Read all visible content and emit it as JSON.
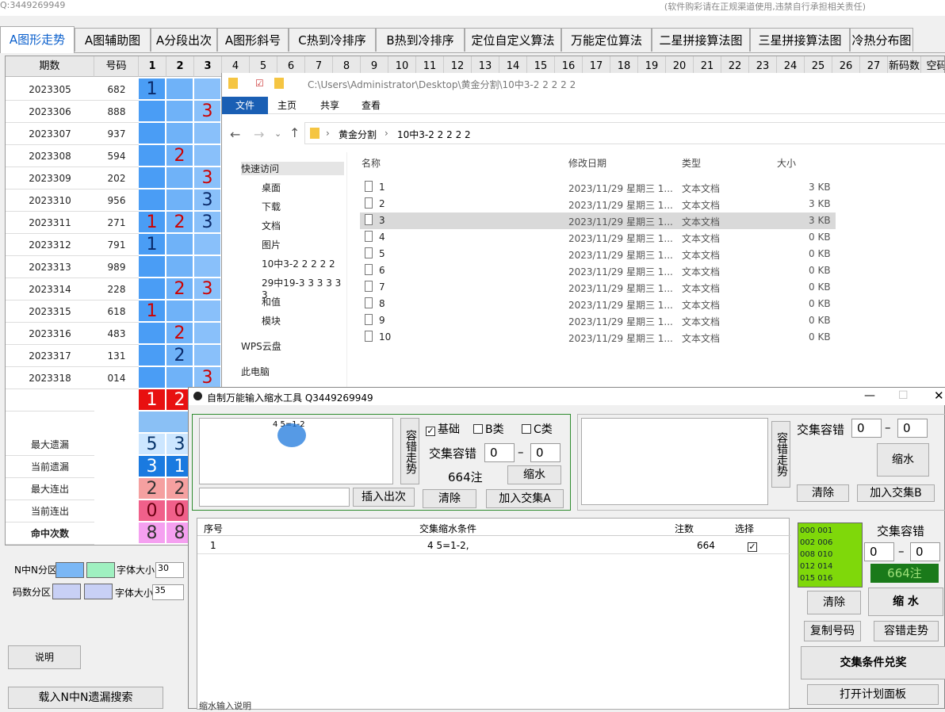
{
  "topbar": {
    "left": "Q:3449269949",
    "right": "(软件购彩请在正规渠道使用,违禁自行承担相关责任)"
  },
  "tabs": [
    "A图形走势",
    "A图辅助图",
    "A分段出次",
    "A图形斜号",
    "C热到冷排序",
    "B热到冷排序",
    "定位自定义算法",
    "万能定位算法",
    "二星拼接算法图",
    "三星拼接算法图",
    "冷热分布图"
  ],
  "grid": {
    "headers": {
      "period": "期数",
      "code": "号码",
      "nums": [
        "1",
        "2",
        "3",
        "4",
        "5",
        "6",
        "7",
        "8",
        "9",
        "10",
        "11",
        "12",
        "13",
        "14",
        "15",
        "16",
        "17",
        "18",
        "19",
        "20",
        "21",
        "22",
        "23",
        "24",
        "25",
        "26",
        "27"
      ],
      "newcode": "新码数",
      "empty": "空码"
    },
    "rows": [
      {
        "p": "2023305",
        "c": "682",
        "d": [
          "1",
          "",
          ""
        ]
      },
      {
        "p": "2023306",
        "c": "888",
        "d": [
          "",
          "",
          "3"
        ]
      },
      {
        "p": "2023307",
        "c": "937",
        "d": [
          "",
          "",
          ""
        ]
      },
      {
        "p": "2023308",
        "c": "594",
        "d": [
          "",
          "2",
          ""
        ]
      },
      {
        "p": "2023309",
        "c": "202",
        "d": [
          "",
          "",
          "3"
        ]
      },
      {
        "p": "2023310",
        "c": "956",
        "d": [
          "",
          "",
          "3"
        ]
      },
      {
        "p": "2023311",
        "c": "271",
        "d": [
          "1",
          "2",
          "3"
        ]
      },
      {
        "p": "2023312",
        "c": "791",
        "d": [
          "1",
          "",
          ""
        ]
      },
      {
        "p": "2023313",
        "c": "989",
        "d": [
          "",
          "",
          ""
        ]
      },
      {
        "p": "2023314",
        "c": "228",
        "d": [
          "",
          "2",
          "3"
        ]
      },
      {
        "p": "2023315",
        "c": "618",
        "d": [
          "1",
          "",
          ""
        ]
      },
      {
        "p": "2023316",
        "c": "483",
        "d": [
          "",
          "2",
          ""
        ]
      },
      {
        "p": "2023317",
        "c": "131",
        "d": [
          "",
          "2",
          ""
        ]
      },
      {
        "p": "2023318",
        "c": "014",
        "d": [
          "",
          "",
          "3"
        ]
      }
    ],
    "predict": [
      "1",
      "2"
    ],
    "stats": [
      {
        "label": "最大遗漏",
        "v": [
          "5",
          "3"
        ]
      },
      {
        "label": "当前遗漏",
        "v": [
          "3",
          "1"
        ]
      },
      {
        "label": "最大连出",
        "v": [
          "2",
          "2"
        ]
      },
      {
        "label": "当前连出",
        "v": [
          "0",
          "0"
        ]
      },
      {
        "label": "命中次数",
        "v": [
          "8",
          "8"
        ]
      }
    ]
  },
  "left_panel": {
    "nzone": "N中N分区",
    "fsize": "字体大小",
    "fsize1": "30",
    "codezone": "码数分区",
    "fsize2": "35",
    "explain": "说明",
    "load": "载入N中N遗漏搜索"
  },
  "explorer": {
    "path": "C:\\Users\\Administrator\\Desktop\\黄金分割\\10中3-2 2 2 2 2",
    "ribbon": [
      "文件",
      "主页",
      "共享",
      "查看"
    ],
    "crumbs": [
      "黄金分割",
      "10中3-2 2 2 2 2"
    ],
    "cols": [
      "名称",
      "修改日期",
      "类型",
      "大小"
    ],
    "nav": [
      "快速访问",
      "桌面",
      "下载",
      "文档",
      "图片",
      "10中3-2 2 2 2 2",
      "29中19-3 3 3 3 3 3",
      "和值",
      "模块",
      "WPS云盘",
      "此电脑"
    ],
    "files": [
      {
        "n": "1",
        "d": "2023/11/29 星期三 1...",
        "t": "文本文档",
        "s": "3 KB"
      },
      {
        "n": "2",
        "d": "2023/11/29 星期三 1...",
        "t": "文本文档",
        "s": "3 KB"
      },
      {
        "n": "3",
        "d": "2023/11/29 星期三 1...",
        "t": "文本文档",
        "s": "3 KB"
      },
      {
        "n": "4",
        "d": "2023/11/29 星期三 1...",
        "t": "文本文档",
        "s": "0 KB"
      },
      {
        "n": "5",
        "d": "2023/11/29 星期三 1...",
        "t": "文本文档",
        "s": "0 KB"
      },
      {
        "n": "6",
        "d": "2023/11/29 星期三 1...",
        "t": "文本文档",
        "s": "0 KB"
      },
      {
        "n": "7",
        "d": "2023/11/29 星期三 1...",
        "t": "文本文档",
        "s": "0 KB"
      },
      {
        "n": "8",
        "d": "2023/11/29 星期三 1...",
        "t": "文本文档",
        "s": "0 KB"
      },
      {
        "n": "9",
        "d": "2023/11/29 星期三 1...",
        "t": "文本文档",
        "s": "0 KB"
      },
      {
        "n": "10",
        "d": "2023/11/29 星期三 1...",
        "t": "文本文档",
        "s": "0 KB"
      }
    ]
  },
  "tool": {
    "title": "自制万能输入缩水工具 Q3449269949",
    "input_text": "4 5=1-2",
    "tolerance_trend": "容错走势",
    "basic": "基础",
    "b": "B类",
    "c": "C类",
    "cross_tol": "交集容错",
    "spin0": "0",
    "count": "664注",
    "shrink": "缩水",
    "insert": "插入出次",
    "clear": "清除",
    "addA": "加入交集A",
    "addB": "加入交集B",
    "table_cols": [
      "序号",
      "交集缩水条件",
      "注数",
      "选择"
    ],
    "table_row": {
      "i": "1",
      "cond": "4 5=1-2,",
      "n": "664"
    },
    "nums_list": [
      "000 001",
      "002 006",
      "008 010",
      "012 014",
      "015 016"
    ],
    "count_green": "664注",
    "shrink_bold": "缩 水",
    "copy": "复制号码",
    "tol_trend2": "容错走势",
    "redeem": "交集条件兑奖",
    "plan": "打开计划面板",
    "bottom_tab": "缩水输入说明"
  }
}
